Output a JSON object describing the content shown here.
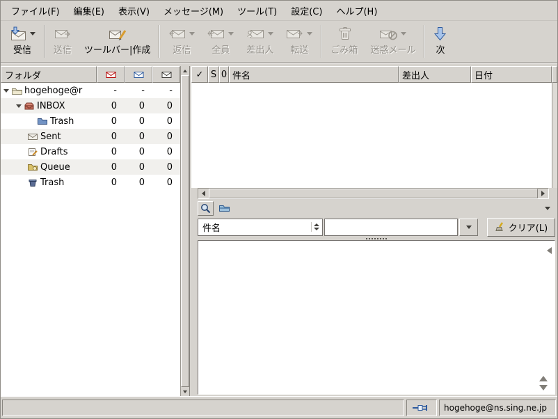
{
  "theme": {
    "window_bg": "#d6d3ce",
    "accent_blue": "#2d5a9e",
    "white": "#ffffff",
    "disabled_text": "#94918b"
  },
  "menubar": {
    "items": [
      {
        "label": "ファイル(F)"
      },
      {
        "label": "編集(E)"
      },
      {
        "label": "表示(V)"
      },
      {
        "label": "メッセージ(M)"
      },
      {
        "label": "ツール(T)"
      },
      {
        "label": "設定(C)"
      },
      {
        "label": "ヘルプ(H)"
      }
    ]
  },
  "toolbar": {
    "buttons": [
      {
        "label": "受信",
        "icon": "receive-icon",
        "enabled": true,
        "dropdown": true
      },
      {
        "label": "送信",
        "icon": "send-icon",
        "enabled": false,
        "dropdown": false
      },
      {
        "label": "ツールバー|作成",
        "icon": "compose-icon",
        "enabled": true,
        "dropdown": false
      },
      {
        "label": "返信",
        "icon": "reply-icon",
        "enabled": false,
        "dropdown": true
      },
      {
        "label": "全員",
        "icon": "reply-all-icon",
        "enabled": false,
        "dropdown": true
      },
      {
        "label": "差出人",
        "icon": "reply-sender-icon",
        "enabled": false,
        "dropdown": true
      },
      {
        "label": "転送",
        "icon": "forward-icon",
        "enabled": false,
        "dropdown": true
      },
      {
        "label": "ごみ箱",
        "icon": "trash-icon",
        "enabled": false,
        "dropdown": false
      },
      {
        "label": "迷惑メール",
        "icon": "junk-icon",
        "enabled": false,
        "dropdown": true
      },
      {
        "label": "次",
        "icon": "next-icon",
        "enabled": true,
        "dropdown": false
      }
    ]
  },
  "folder_pane": {
    "header": {
      "title": "フォルダ",
      "columns": [
        "new-mail-icon",
        "unread-mail-icon",
        "total-mail-icon"
      ]
    },
    "rows": [
      {
        "name": "hogehoge@r",
        "new": "-",
        "unread": "-",
        "total": "-",
        "icon": "account-folder-icon",
        "level": 0,
        "expanded": true
      },
      {
        "name": "INBOX",
        "new": "0",
        "unread": "0",
        "total": "0",
        "icon": "inbox-icon",
        "level": 1,
        "expanded": true
      },
      {
        "name": "Trash",
        "new": "0",
        "unread": "0",
        "total": "0",
        "icon": "folder-icon",
        "level": 2,
        "expanded": false
      },
      {
        "name": "Sent",
        "new": "0",
        "unread": "0",
        "total": "0",
        "icon": "sent-icon",
        "level": 1,
        "expanded": false
      },
      {
        "name": "Drafts",
        "new": "0",
        "unread": "0",
        "total": "0",
        "icon": "drafts-icon",
        "level": 1,
        "expanded": false
      },
      {
        "name": "Queue",
        "new": "0",
        "unread": "0",
        "total": "0",
        "icon": "queue-icon",
        "level": 1,
        "expanded": false
      },
      {
        "name": "Trash",
        "new": "0",
        "unread": "0",
        "total": "0",
        "icon": "trash-folder-icon",
        "level": 1,
        "expanded": false
      }
    ]
  },
  "message_list": {
    "columns": [
      {
        "label": "✓"
      },
      {
        "label": "S"
      },
      {
        "label": "0"
      },
      {
        "label": "件名"
      },
      {
        "label": "差出人"
      },
      {
        "label": "日付"
      }
    ],
    "rows": []
  },
  "quick_search": {
    "field": "件名",
    "query": "",
    "clear_label": "クリア(L)"
  },
  "statusbar": {
    "account": "hogehoge@ns.sing.ne.jp"
  }
}
